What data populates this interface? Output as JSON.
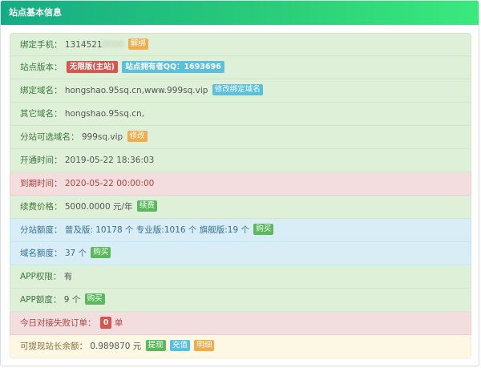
{
  "header": {
    "title": "站点基本信息"
  },
  "rows": {
    "phone": {
      "label": "绑定手机：",
      "value": "1314521",
      "masked": "0000",
      "unbind": "解绑"
    },
    "version": {
      "label": "站点版本：",
      "badge": "无限版(主站)",
      "qq_badge": "站点拥有者QQ：1693696"
    },
    "domain": {
      "label": "绑定域名：",
      "value": "hongshao.95sq.cn,www.999sq.vip",
      "btn": "修改绑定域名"
    },
    "other_domain": {
      "label": "其它域名：",
      "value": "hongshao.95sq.cn,"
    },
    "sub_domain": {
      "label": "分站可选域名：",
      "value": "999sq.vip",
      "btn": "修改"
    },
    "open_time": {
      "label": "开通时间：",
      "value": "2019-05-22 18:36:03"
    },
    "expire_time": {
      "label": "到期时间：",
      "value": "2020-05-22 00:00:00"
    },
    "renew_price": {
      "label": "续费价格：",
      "value": "5000.0000 元/年",
      "btn": "续费"
    },
    "quota": {
      "label": "分站额度：",
      "value": "普及版: 10178 个 专业版:1016 个 旗舰版:19 个",
      "btn": "购买"
    },
    "domain_quota": {
      "label": "域名额度：",
      "value": "37 个",
      "btn": "购买"
    },
    "app_permission": {
      "label": "APP权限：",
      "value": "有"
    },
    "app_quota": {
      "label": "APP额度：",
      "value": "9 个",
      "btn": "购买"
    },
    "failed_orders": {
      "label": "今日对接失败订单：",
      "count": "0",
      "unit": "单"
    },
    "balance": {
      "label": "可提现站长余额：",
      "value": "0.989870 元",
      "withdraw": "提现",
      "recharge": "充值",
      "detail": "明细"
    }
  },
  "colors": {
    "header_gradient_start": "#14ac85",
    "header_gradient_end": "#39ea7c",
    "success_bg": "#dff0d8",
    "danger_bg": "#f2dede",
    "info_bg": "#d9edf7",
    "warning_bg": "#fcf8e3"
  }
}
